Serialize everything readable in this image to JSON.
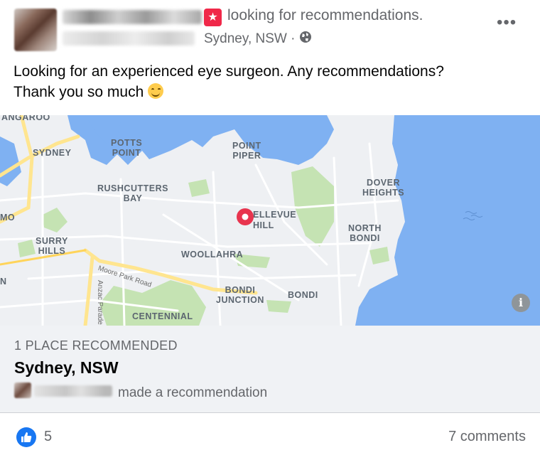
{
  "header": {
    "tag_text": "looking for recommendations.",
    "location": "Sydney, NSW ·",
    "more_label": "•••"
  },
  "post": {
    "line1": "Looking for an experienced eye surgeon. Any recommendations?",
    "line2": "Thank you so much"
  },
  "map": {
    "labels": {
      "kangaroo": "ANGAROO",
      "sydney": "SYDNEY",
      "potts_point": "POTTS\nPOINT",
      "point_piper": "POINT\nPIPER",
      "rushcutters_bay": "RUSHCUTTERS\nBAY",
      "dover_heights": "DOVER\nHEIGHTS",
      "mo": "MO",
      "bellevue_hill": "ELLEVUE\nHILL",
      "north_bondi": "NORTH\nBONDI",
      "surry_hills": "SURRY\nHILLS",
      "woollahra": "WOOLLAHRA",
      "n": "N",
      "bondi_junction": "BONDI\nJUNCTION",
      "bondi": "BONDI",
      "centennial": "CENTENNIAL",
      "moore_park_road": "Moore Park Road",
      "anzac_parade": "Anzac Parade"
    },
    "info_label": "i",
    "colors": {
      "water": "#7fb1f2",
      "land": "#eef0f3",
      "park": "#c5e3b3",
      "road_major": "#ffe58f",
      "pin": "#e8344e"
    }
  },
  "place": {
    "count_label": "1 PLACE RECOMMENDED",
    "name": "Sydney, NSW",
    "recommendation_text": "made a recommendation"
  },
  "footer": {
    "likes": "5",
    "comments": "7 comments",
    "like_color": "#1877f2"
  },
  "icons": [
    "recommendation-icon",
    "globe-icon",
    "more-options-icon",
    "smile-emoji-icon",
    "map-pin-icon",
    "info-icon",
    "like-icon"
  ]
}
